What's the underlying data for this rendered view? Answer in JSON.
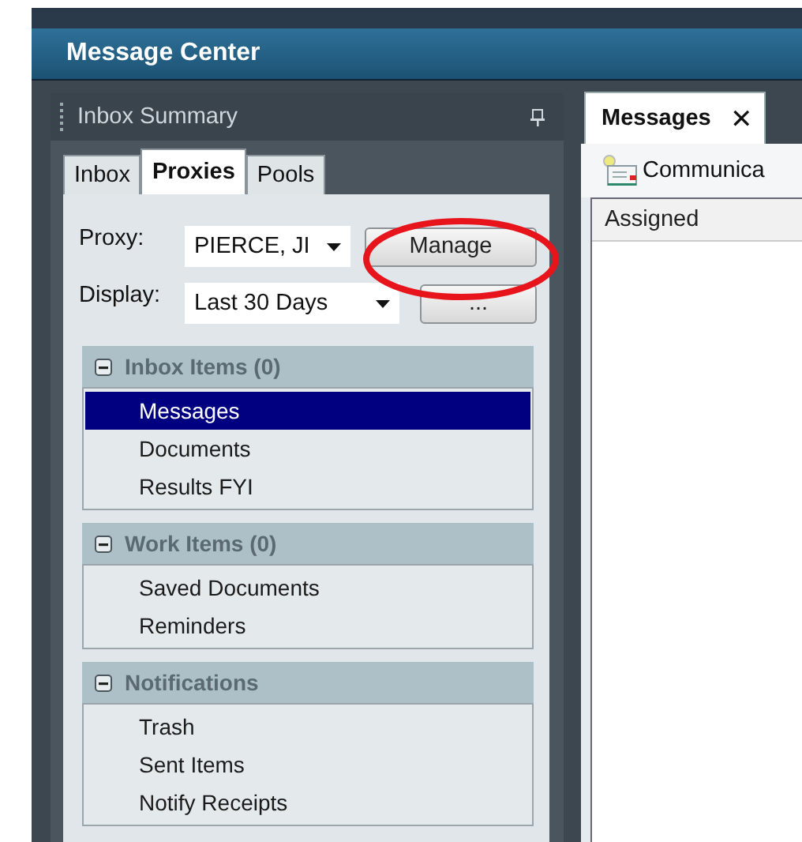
{
  "window": {
    "title": "Message Center"
  },
  "panel": {
    "title": "Inbox Summary",
    "tabs": [
      {
        "label": "Inbox",
        "selected": false
      },
      {
        "label": "Proxies",
        "selected": true
      },
      {
        "label": "Pools",
        "selected": false
      }
    ],
    "proxy": {
      "label": "Proxy:",
      "value": "PIERCE, JI"
    },
    "manage_button": "Manage",
    "display": {
      "label": "Display:",
      "value": "Last 30 Days"
    },
    "more_button": "...",
    "sections": [
      {
        "title": "Inbox Items (0)",
        "expanded": true,
        "items": [
          {
            "label": "Messages",
            "selected": true
          },
          {
            "label": "Documents",
            "selected": false
          },
          {
            "label": "Results FYI",
            "selected": false
          }
        ]
      },
      {
        "title": "Work Items (0)",
        "expanded": true,
        "items": [
          {
            "label": "Saved Documents",
            "selected": false
          },
          {
            "label": "Reminders",
            "selected": false
          }
        ]
      },
      {
        "title": "Notifications",
        "expanded": true,
        "items": [
          {
            "label": "Trash",
            "selected": false
          },
          {
            "label": "Sent Items",
            "selected": false
          },
          {
            "label": "Notify Receipts",
            "selected": false
          }
        ]
      }
    ]
  },
  "content": {
    "tabs": [
      {
        "label": "Messages",
        "close": "✕",
        "selected": true
      }
    ],
    "toolbar": [
      "Communica"
    ],
    "table": {
      "columns": [
        "Assigned"
      ]
    }
  },
  "annotations": [
    {
      "kind": "ellipse"
    }
  ]
}
